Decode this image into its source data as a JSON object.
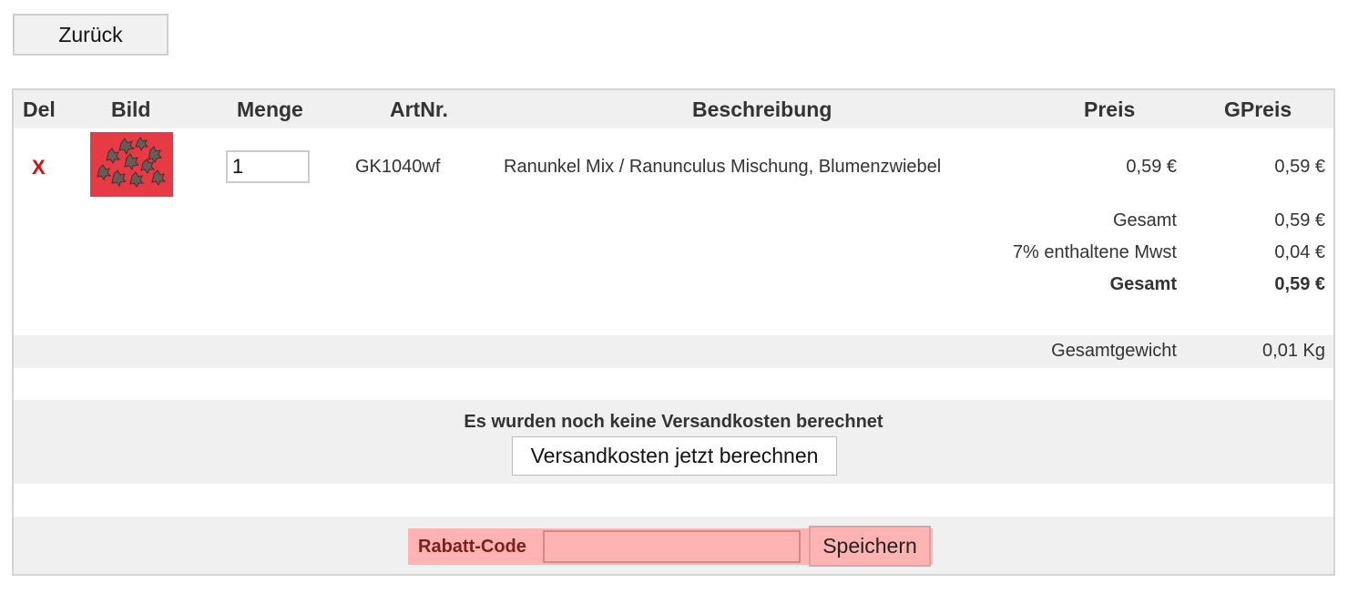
{
  "back_button": "Zurück",
  "columns": {
    "del": "Del",
    "bild": "Bild",
    "menge": "Menge",
    "artnr": "ArtNr.",
    "beschreibung": "Beschreibung",
    "preis": "Preis",
    "gpreis": "GPreis"
  },
  "item": {
    "delete_symbol": "X",
    "quantity": "1",
    "artnr": "GK1040wf",
    "description": "Ranunkel Mix / Ranunculus Mischung, Blumenzwiebel",
    "price": "0,59 €",
    "total_price": "0,59 €"
  },
  "totals": {
    "subtotal_label": "Gesamt",
    "subtotal_value": "0,59 €",
    "tax_label": "7% enthaltene Mwst",
    "tax_value": "0,04 €",
    "grand_total_label": "Gesamt",
    "grand_total_value": "0,59 €"
  },
  "weight": {
    "label": "Gesamtgewicht",
    "value": "0,01 Kg"
  },
  "shipping": {
    "notice": "Es wurden noch keine Versandkosten berechnet",
    "button": "Versandkosten jetzt berechnen"
  },
  "discount": {
    "label": "Rabatt-Code",
    "input_value": "",
    "button": "Speichern"
  },
  "colors": {
    "delete": "#cc1111",
    "header_bg": "#f0f0f0",
    "discount_bg": "#ffb3b3",
    "thumbnail_bg": "#e63a45"
  }
}
